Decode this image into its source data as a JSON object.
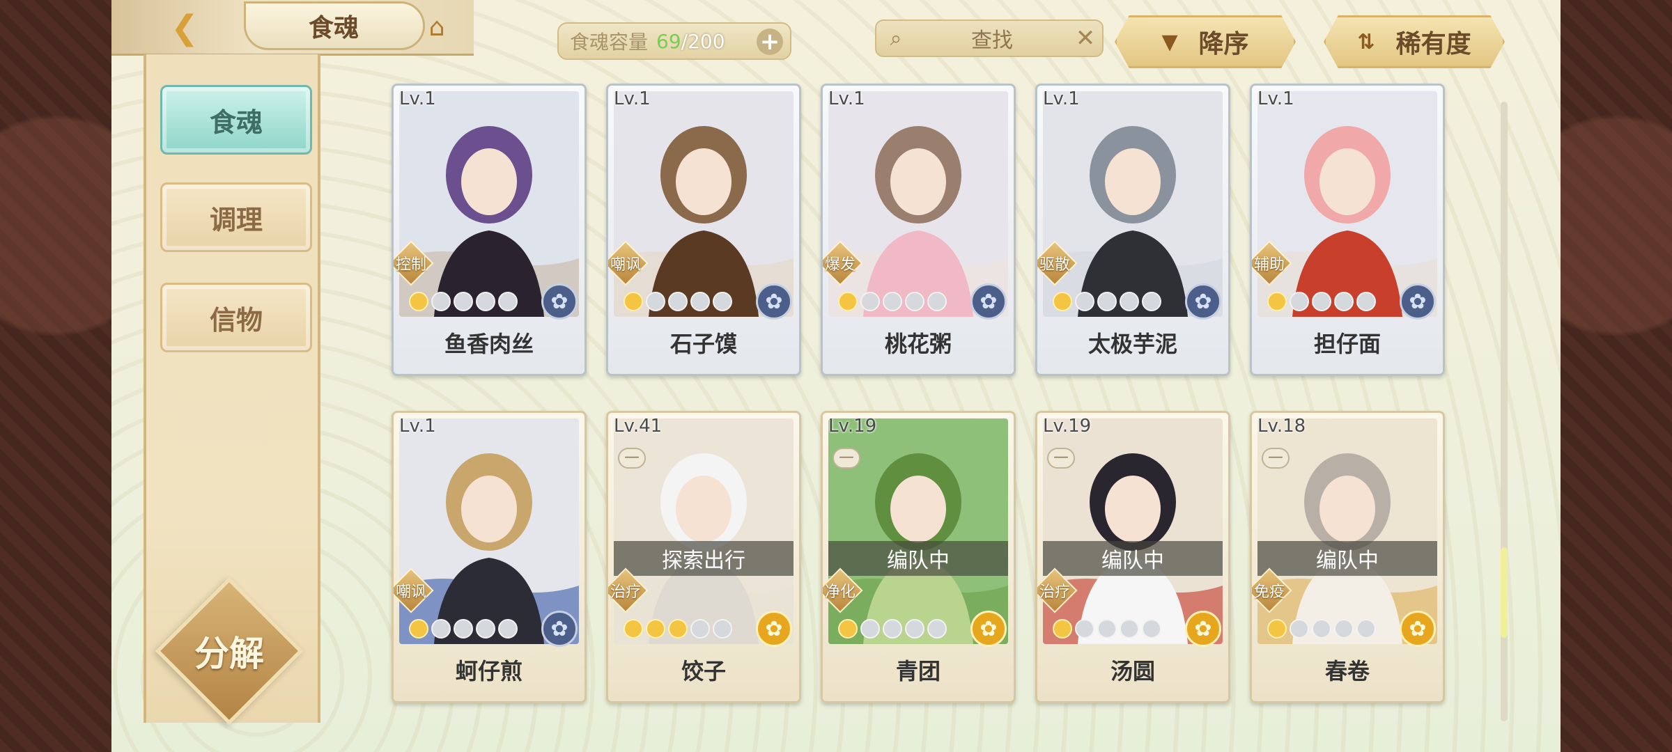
{
  "header": {
    "title": "食魂",
    "capacity_label": "食魂容量",
    "capacity_current": "69",
    "capacity_max": "/200",
    "search_label": "查找",
    "sort_desc_label": "降序",
    "sort_rarity_label": "稀有度"
  },
  "sidebar": {
    "items": [
      {
        "label": "食魂",
        "active": true
      },
      {
        "label": "调理",
        "active": false
      },
      {
        "label": "信物",
        "active": false
      }
    ],
    "decompose_label": "分解"
  },
  "cards": [
    {
      "level": "Lv.1",
      "name": "鱼香肉丝",
      "role": "控制",
      "stars_filled": 1,
      "stars_total": 5,
      "emblem": "blue-flower",
      "status": "",
      "locked": false
    },
    {
      "level": "Lv.1",
      "name": "石子馍",
      "role": "嘲讽",
      "stars_filled": 1,
      "stars_total": 5,
      "emblem": "blue-flower",
      "status": "",
      "locked": false
    },
    {
      "level": "Lv.1",
      "name": "桃花粥",
      "role": "爆发",
      "stars_filled": 1,
      "stars_total": 5,
      "emblem": "blue-flower",
      "status": "",
      "locked": false
    },
    {
      "level": "Lv.1",
      "name": "太极芋泥",
      "role": "驱散",
      "stars_filled": 1,
      "stars_total": 5,
      "emblem": "blue-flower",
      "status": "",
      "locked": false
    },
    {
      "level": "Lv.1",
      "name": "担仔面",
      "role": "辅助",
      "stars_filled": 1,
      "stars_total": 5,
      "emblem": "blue-flower",
      "status": "",
      "locked": false
    },
    {
      "level": "Lv.1",
      "name": "蚵仔煎",
      "role": "嘲讽",
      "stars_filled": 1,
      "stars_total": 5,
      "emblem": "blue-flower",
      "status": "",
      "locked": false
    },
    {
      "level": "Lv.41",
      "name": "饺子",
      "role": "治疗",
      "stars_filled": 3,
      "stars_total": 5,
      "emblem": "gold-flower",
      "status": "探索出行",
      "locked": true
    },
    {
      "level": "Lv.19",
      "name": "青团",
      "role": "净化",
      "stars_filled": 1,
      "stars_total": 5,
      "emblem": "gold-flower",
      "status": "编队中",
      "locked": true
    },
    {
      "level": "Lv.19",
      "name": "汤圆",
      "role": "治疗",
      "stars_filled": 1,
      "stars_total": 5,
      "emblem": "gold-flower",
      "status": "编队中",
      "locked": true
    },
    {
      "level": "Lv.18",
      "name": "春卷",
      "role": "免疫",
      "stars_filled": 1,
      "stars_total": 5,
      "emblem": "gold-flower",
      "status": "编队中",
      "locked": true
    }
  ],
  "colors": {
    "accent_gold": "#d7b26a",
    "active_tab": "#8fd5c9",
    "capacity_current": "#7ccb56"
  }
}
